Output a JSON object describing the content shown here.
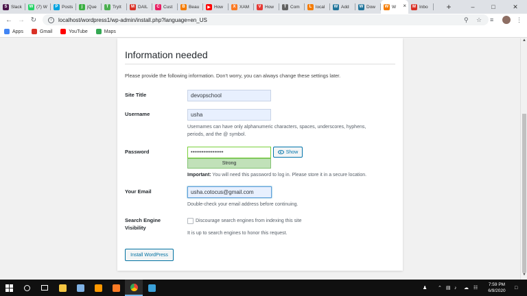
{
  "browser": {
    "tabs": [
      {
        "label": "Slack",
        "color": "#4a154b",
        "glyph": "S"
      },
      {
        "label": "(7) W",
        "color": "#25d366",
        "glyph": "W"
      },
      {
        "label": "Posts",
        "color": "#00a3e0",
        "glyph": "P"
      },
      {
        "label": "jQue",
        "color": "#3cb043",
        "glyph": "j"
      },
      {
        "label": "TryIt",
        "color": "#4caf50",
        "glyph": "T"
      },
      {
        "label": "DAIL",
        "color": "#d93025",
        "glyph": "M"
      },
      {
        "label": "Cust",
        "color": "#e91e63",
        "glyph": "C"
      },
      {
        "label": "Beau",
        "color": "#f57c00",
        "glyph": "B"
      },
      {
        "label": "How",
        "color": "#ff0000",
        "glyph": "▶"
      },
      {
        "label": "XAM",
        "color": "#fb7a24",
        "glyph": "X"
      },
      {
        "label": "How",
        "color": "#e53935",
        "glyph": "V"
      },
      {
        "label": "Com",
        "color": "#616161",
        "glyph": "T"
      },
      {
        "label": "local",
        "color": "#f57c00",
        "glyph": "L"
      },
      {
        "label": "Add",
        "color": "#21759b",
        "glyph": "W"
      },
      {
        "label": "Dow",
        "color": "#21759b",
        "glyph": "W"
      },
      {
        "label": "W",
        "color": "#f57c00",
        "glyph": "W",
        "active": true
      },
      {
        "label": "Inbo",
        "color": "#d93025",
        "glyph": "M"
      }
    ],
    "url": "localhost/wordpress1/wp-admin/install.php?language=en_US",
    "bookmarks": [
      {
        "label": "Apps",
        "color": "#4285f4"
      },
      {
        "label": "Gmail",
        "color": "#d93025"
      },
      {
        "label": "YouTube",
        "color": "#ff0000"
      },
      {
        "label": "Maps",
        "color": "#34a853"
      }
    ]
  },
  "form": {
    "heading": "Information needed",
    "intro": "Please provide the following information. Don’t worry, you can always change these settings later.",
    "site_title_label": "Site Title",
    "site_title_value": "devopschool",
    "username_label": "Username",
    "username_value": "usha",
    "username_hint_1": "Usernames can have only alphanumeric characters, spaces, underscores, hyphens,",
    "username_hint_2": "periods, and the @ symbol.",
    "password_label": "Password",
    "password_value": "••••••••••••••••••",
    "show_label": "Show",
    "strength_label": "Strong",
    "password_note_bold": "Important:",
    "password_note": " You will need this password to log in. Please store it in a secure location.",
    "email_label": "Your Email",
    "email_value": "usha.cotocus@gmail.com",
    "email_hint": "Double-check your email address before continuing.",
    "visibility_label_1": "Search Engine",
    "visibility_label_2": "Visibility",
    "visibility_checkbox_label": "Discourage search engines from indexing this site",
    "visibility_hint": "It is up to search engines to honor this request.",
    "install_button": "Install WordPress"
  },
  "taskbar": {
    "time": "7:59 PM",
    "date": "6/9/2020"
  }
}
